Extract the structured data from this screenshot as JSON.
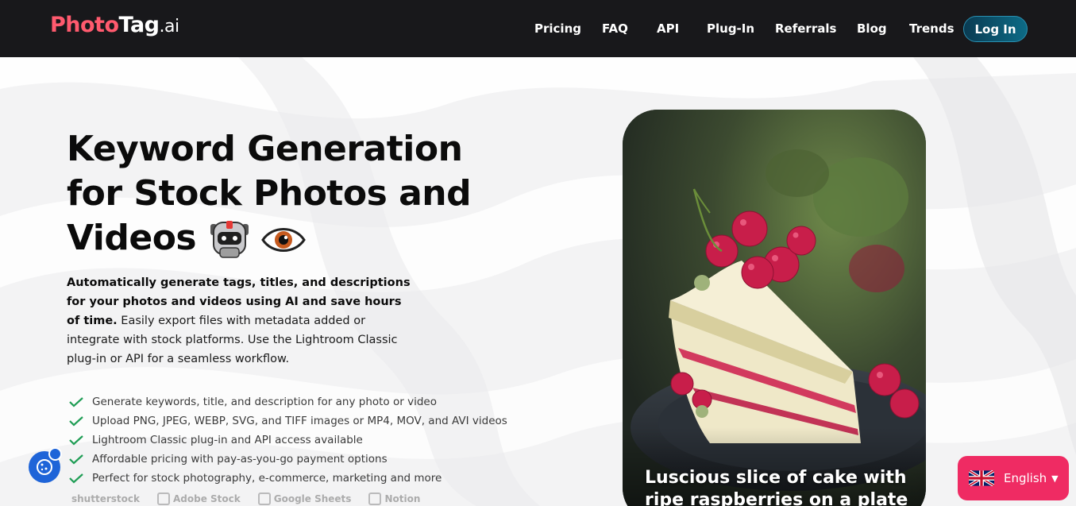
{
  "nav": {
    "logo_part1": "Photo",
    "logo_part2": "Tag",
    "logo_part3": ".ai",
    "links": [
      "Pricing",
      "FAQ",
      "API",
      "Plug-In",
      "Referrals",
      "Blog",
      "Trends"
    ],
    "login_label": "Log In"
  },
  "hero": {
    "title_line1": "Keyword Generation",
    "title_line2": "for Stock Photos and",
    "title_line3": "Videos",
    "desc_bold": "Automatically generate tags, titles, and descriptions for your photos and videos using AI and save hours of time.",
    "desc_normal": "Easily export files with metadata added or integrate with stock platforms. Use the Lightroom Classic plug-in or API for a seamless workflow."
  },
  "features": [
    "Generate keywords, title, and description for any photo or video",
    "Upload PNG, JPEG, WEBP, SVG, and TIFF images or MP4, MOV, and AVI videos",
    "Lightroom Classic plug-in and API access available",
    "Affordable pricing with pay-as-you-go payment options",
    "Perfect for stock photography, e-commerce, marketing and more"
  ],
  "partners": [
    "shutterstock",
    "Adobe Stock",
    "Google Sheets",
    "Notion"
  ],
  "phone": {
    "caption": "Luscious slice of cake with ripe raspberries on a plate"
  },
  "language": {
    "label": "English"
  },
  "colors": {
    "nav_bg": "#18181b",
    "logo_accent": "#ff5a6e",
    "login_bg": "#0d6b86",
    "check_green": "#1f9d55",
    "lang_bg": "#ef2b63",
    "cookie_bg": "#1e64d8"
  },
  "icons": {
    "robot": "robot-icon",
    "eye": "eye-icon",
    "check": "check-icon",
    "cookie": "cookie-icon",
    "flag": "uk-flag-icon",
    "caret": "caret-down-icon"
  }
}
